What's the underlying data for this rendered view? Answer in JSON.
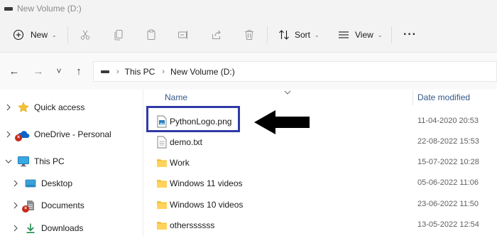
{
  "window": {
    "title": "New Volume (D:)"
  },
  "toolbar": {
    "new_label": "New",
    "sort_label": "Sort",
    "view_label": "View",
    "more_label": "···"
  },
  "address": {
    "back": "←",
    "forward": "→",
    "recent": "˅",
    "up": "↑",
    "crumbs": [
      "This PC",
      "New Volume (D:)"
    ]
  },
  "sidebar": {
    "items": [
      {
        "label": "Quick access",
        "icon": "star-icon"
      },
      {
        "label": "OneDrive - Personal",
        "icon": "cloud-icon"
      },
      {
        "label": "This PC",
        "icon": "monitor-icon"
      },
      {
        "label": "Desktop",
        "icon": "desktop-icon"
      },
      {
        "label": "Documents",
        "icon": "documents-icon"
      },
      {
        "label": "Downloads",
        "icon": "downloads-icon"
      }
    ]
  },
  "filelist": {
    "columns": {
      "name": "Name",
      "date": "Date modified"
    },
    "rows": [
      {
        "name": "PythonLogo.png",
        "date": "11-04-2020 20:53",
        "icon": "image-file-icon"
      },
      {
        "name": "demo.txt",
        "date": "22-08-2022 15:53",
        "icon": "text-file-icon"
      },
      {
        "name": "Work",
        "date": "15-07-2022 10:28",
        "icon": "folder-icon"
      },
      {
        "name": "Windows 11 videos",
        "date": "05-06-2022 11:06",
        "icon": "folder-icon"
      },
      {
        "name": "Windows 10 videos",
        "date": "23-06-2022 11:50",
        "icon": "folder-icon"
      },
      {
        "name": "otherssssss",
        "date": "13-05-2022 12:54",
        "icon": "folder-icon"
      }
    ]
  },
  "colors": {
    "highlight_box": "#2f3aa7",
    "folder": "#f5c33b",
    "accent_blue": "#0067c0",
    "error_badge": "#c42b1c"
  }
}
